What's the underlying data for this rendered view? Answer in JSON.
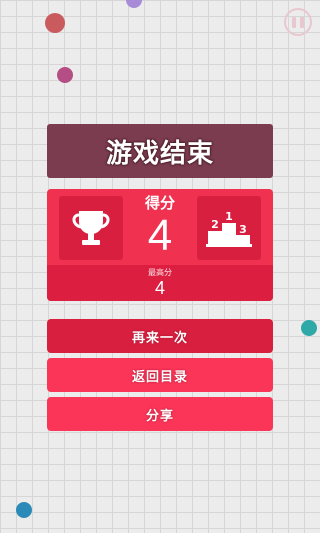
{
  "title": "游戏结束",
  "score": {
    "label": "得分",
    "value": "4"
  },
  "best": {
    "label": "最高分",
    "value": "4"
  },
  "buttons": {
    "retry": "再来一次",
    "menu": "返回目录",
    "share": "分享"
  },
  "podium": {
    "first": "1",
    "second": "2",
    "third": "3"
  },
  "icons": {
    "pause": "pause-icon",
    "trophy": "trophy-icon",
    "podium": "podium-icon"
  },
  "colors": {
    "background": "#ececec",
    "grid": "#d6d6d6",
    "title_banner": "#7a3c4e",
    "panel": "#f0314f",
    "panel_dark": "#d81f3f",
    "button_light": "#fb3558"
  },
  "background_dots": [
    {
      "color": "#c95a5e"
    },
    {
      "color": "#a78ad8"
    },
    {
      "color": "#b54e84"
    },
    {
      "color": "#2fa8a8"
    },
    {
      "color": "#2c8ab8"
    }
  ]
}
